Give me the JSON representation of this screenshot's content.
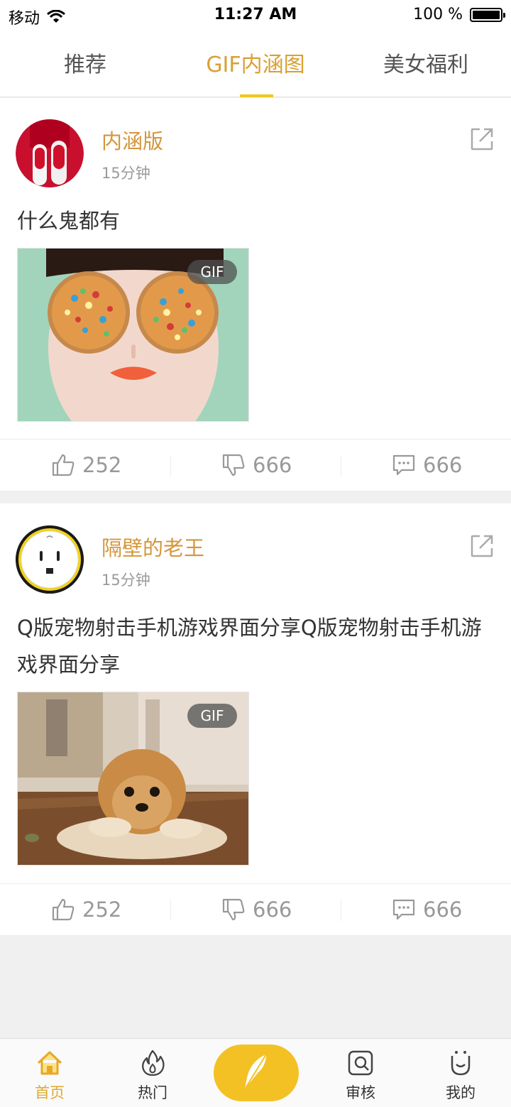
{
  "status_bar": {
    "carrier": "移动",
    "time": "11:27 AM",
    "battery": "100 %"
  },
  "tabs": [
    {
      "label": "推荐",
      "active": false
    },
    {
      "label": "GIF内涵图",
      "active": true
    },
    {
      "label": "美女福利",
      "active": false
    }
  ],
  "posts": [
    {
      "author": "内涵版",
      "time_ago": "15分钟",
      "text": "什么鬼都有",
      "badge": "GIF",
      "likes": "252",
      "dislikes": "666",
      "comments": "666",
      "avatar_icon": "red-nails-avatar",
      "image_icon": "woman-with-jeweled-sunglasses-image"
    },
    {
      "author": "隔壁的老王",
      "time_ago": "15分钟",
      "text": "Q版宠物射击手机游戏界面分享Q版宠物射击手机游戏界面分享",
      "badge": "GIF",
      "likes": "252",
      "dislikes": "666",
      "comments": "666",
      "avatar_icon": "power-socket-avatar",
      "image_icon": "fluffy-puppy-image"
    }
  ],
  "bottom_nav": [
    {
      "label": "首页",
      "icon": "home-icon",
      "active": true
    },
    {
      "label": "热门",
      "icon": "flame-icon",
      "active": false
    },
    {
      "label": "",
      "icon": "feather-icon",
      "active": false
    },
    {
      "label": "审核",
      "icon": "review-icon",
      "active": false
    },
    {
      "label": "我的",
      "icon": "smiley-face-icon",
      "active": false
    }
  ],
  "colors": {
    "accent": "#f4c125",
    "author": "#d4963a",
    "active_tab": "#d9a032"
  }
}
